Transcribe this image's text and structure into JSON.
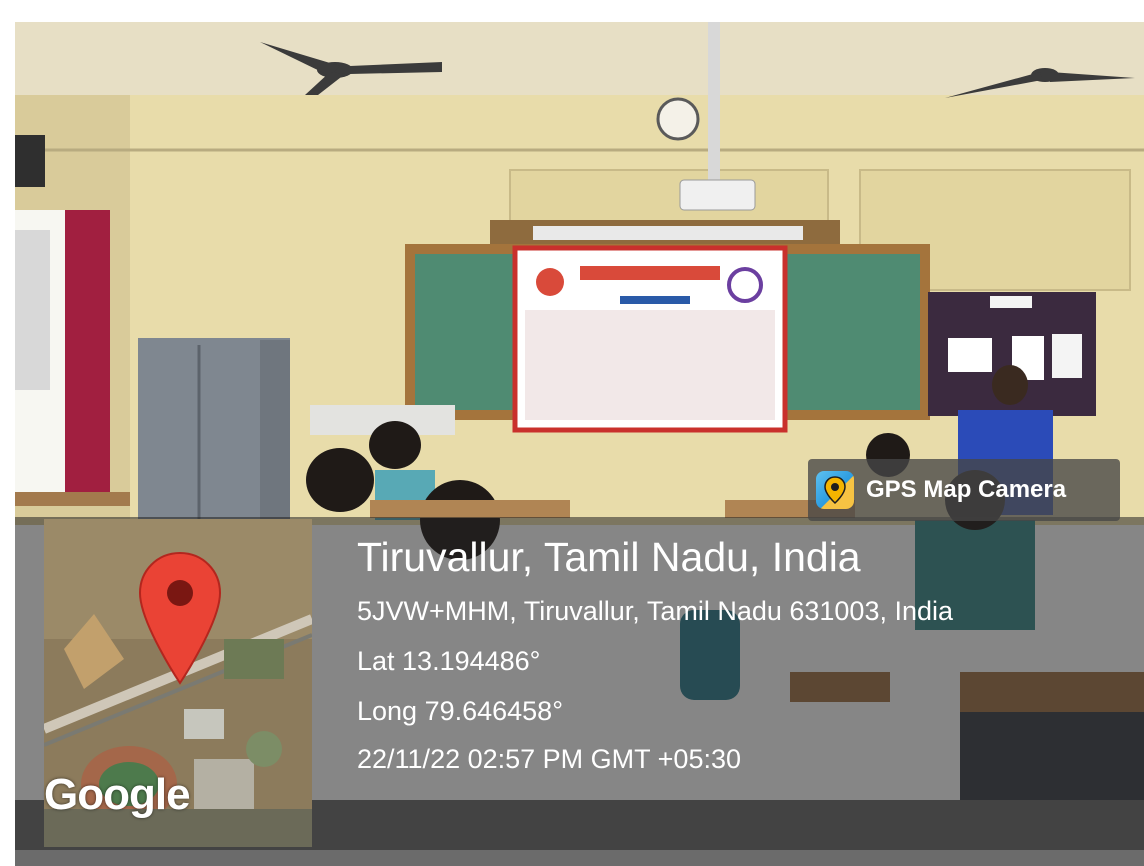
{
  "badge": {
    "label": "GPS Map Camera",
    "icon": "gps-map-camera-icon"
  },
  "map": {
    "attribution": "Google",
    "pin_icon": "map-pin-icon"
  },
  "location": {
    "title": "Tiruvallur, Tamil Nadu, India",
    "address": "5JVW+MHM, Tiruvallur, Tamil Nadu 631003, India",
    "lat": "Lat 13.194486°",
    "long": "Long 79.646458°",
    "datetime": "22/11/22 02:57 PM GMT +05:30"
  },
  "colors": {
    "pin": "#ea4335",
    "overlay": "#232323",
    "text": "#ffffff"
  }
}
